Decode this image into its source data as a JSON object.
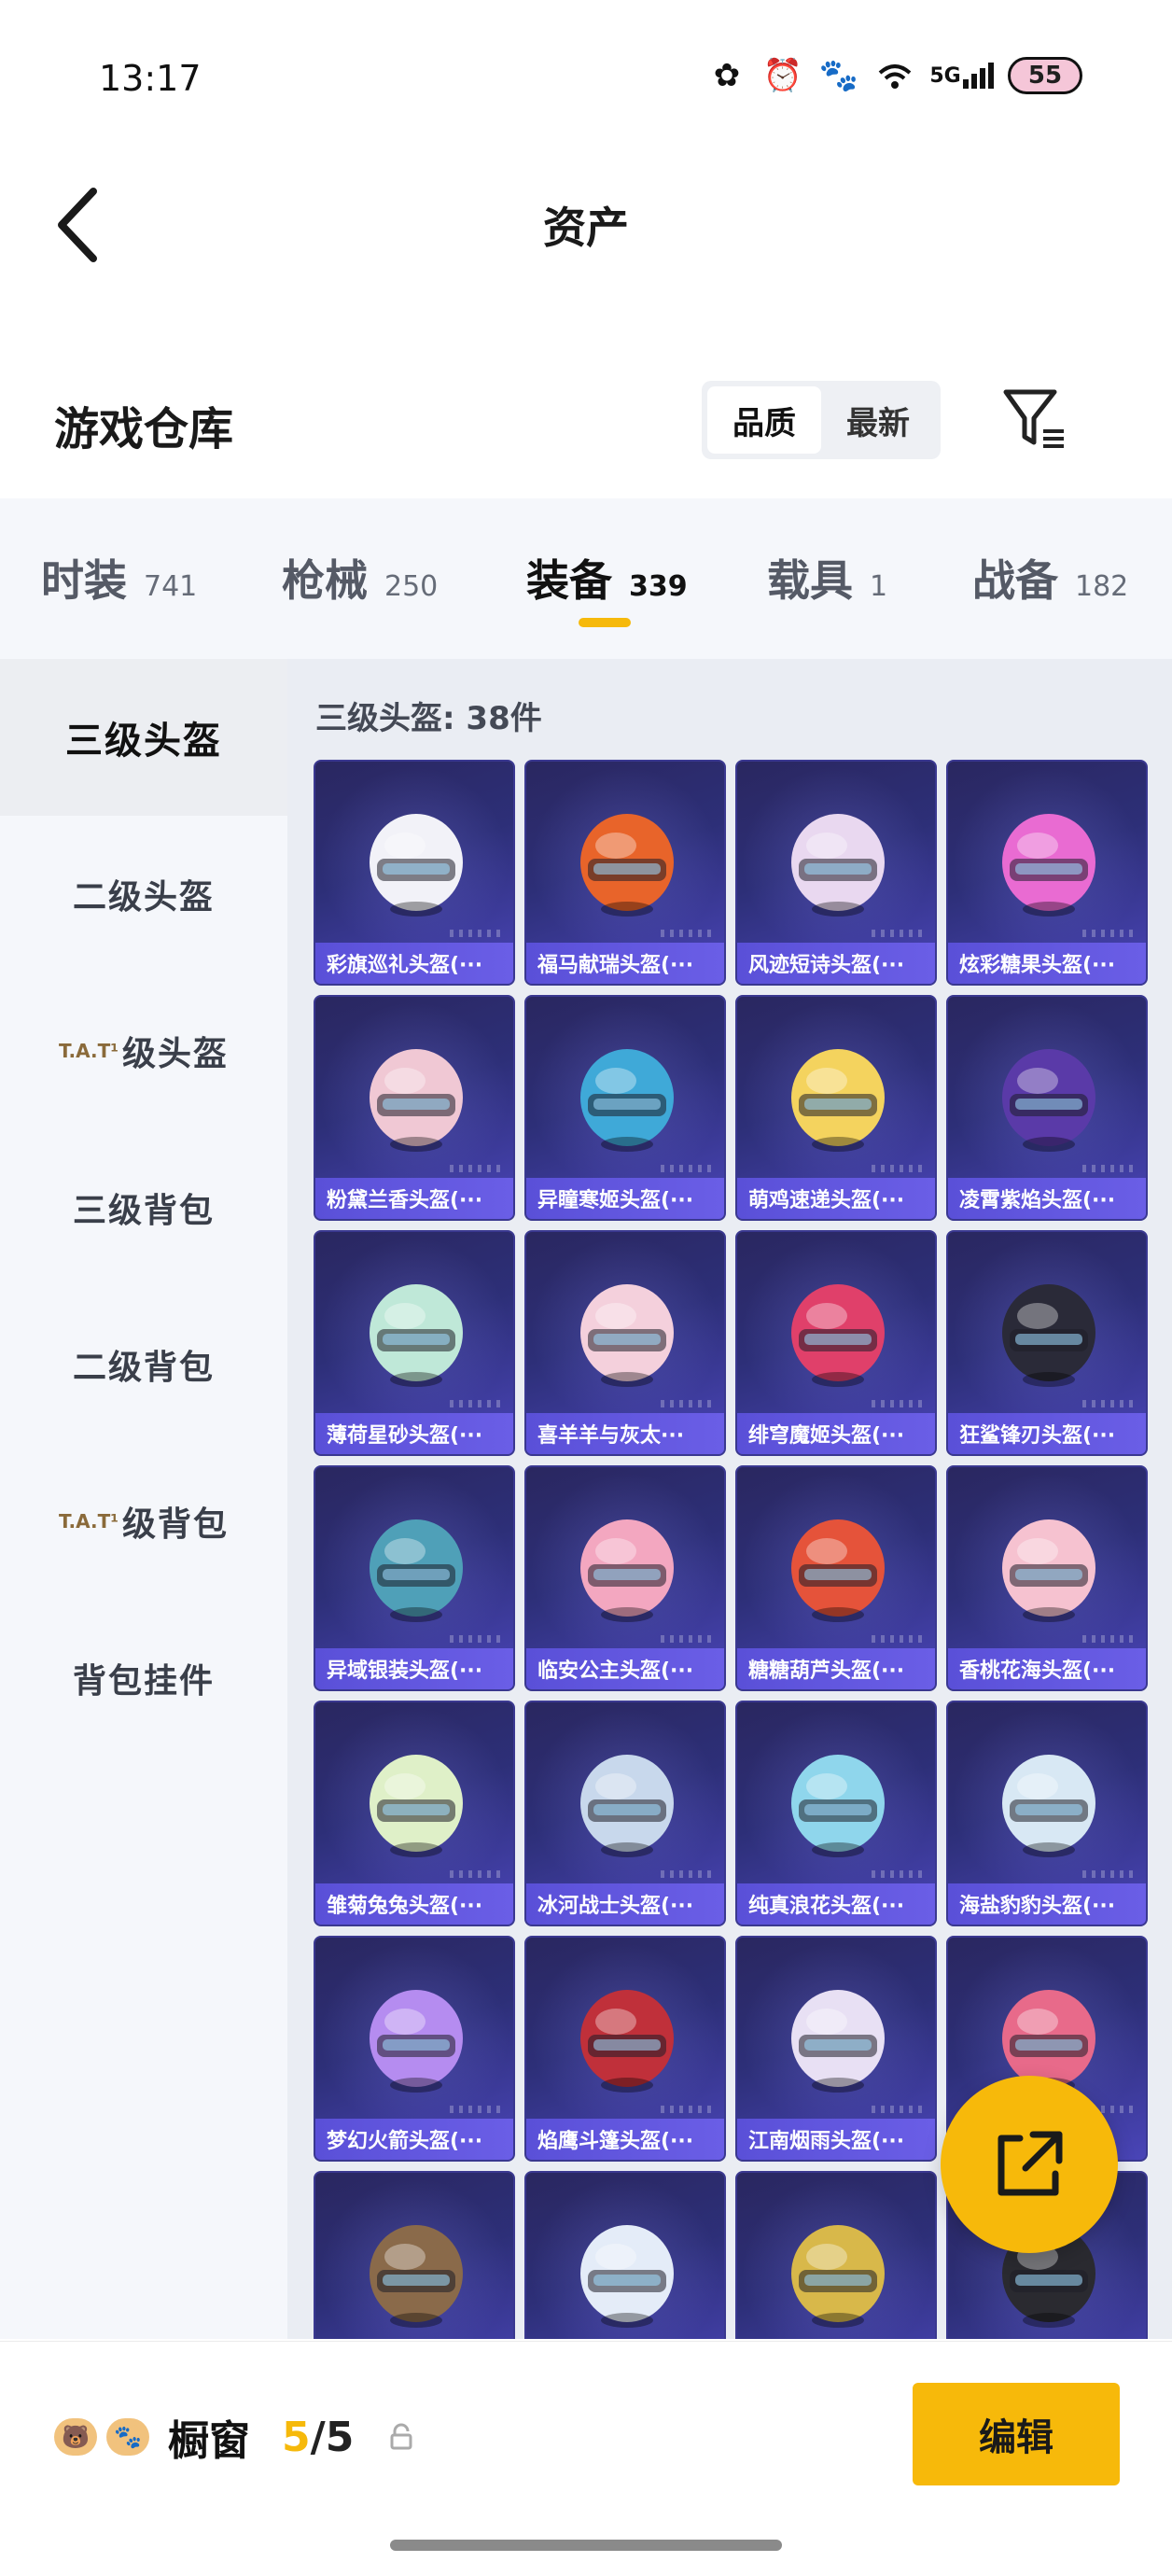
{
  "status_bar": {
    "time": "13:17",
    "network": "5G",
    "battery": "55"
  },
  "header": {
    "title": "资产"
  },
  "warehouse": {
    "title": "游戏仓库",
    "sort": [
      "品质",
      "最新"
    ]
  },
  "tabs": [
    {
      "label": "时装",
      "count": "741"
    },
    {
      "label": "枪械",
      "count": "250"
    },
    {
      "label": "装备",
      "count": "339"
    },
    {
      "label": "载具",
      "count": "1"
    },
    {
      "label": "战备",
      "count": "182"
    }
  ],
  "side_nav": [
    {
      "label": "三级头盔"
    },
    {
      "label": "二级头盔"
    },
    {
      "glitch": "T.A.T¹",
      "label": "级头盔"
    },
    {
      "label": "三级背包"
    },
    {
      "label": "二级背包"
    },
    {
      "glitch": "T.A.T¹",
      "label": "级背包"
    },
    {
      "label": "背包挂件"
    }
  ],
  "content": {
    "count_label": "三级头盔: 38件",
    "items": [
      {
        "name": "彩旗巡礼头盔(···",
        "accent": "#f2f2f8"
      },
      {
        "name": "福马献瑞头盔(···",
        "accent": "#e8642a"
      },
      {
        "name": "风迹短诗头盔(···",
        "accent": "#e9d8f0"
      },
      {
        "name": "炫彩糖果头盔(···",
        "accent": "#e96bd2"
      },
      {
        "name": "粉黛兰香头盔(···",
        "accent": "#f0c8d4"
      },
      {
        "name": "异瞳寒姬头盔(···",
        "accent": "#3fa9d8"
      },
      {
        "name": "萌鸡速递头盔(···",
        "accent": "#f4d35e"
      },
      {
        "name": "凌霄紫焰头盔(···",
        "accent": "#5a3aa8"
      },
      {
        "name": "薄荷星砂头盔(···",
        "accent": "#bfe8d8"
      },
      {
        "name": "喜羊羊与灰太···",
        "accent": "#f4d0dc"
      },
      {
        "name": "绯穹魔姬头盔(···",
        "accent": "#e0406a"
      },
      {
        "name": "狂鲨锋刃头盔(···",
        "accent": "#2a2a38"
      },
      {
        "name": "异域银装头盔(···",
        "accent": "#4fa0b8"
      },
      {
        "name": "临安公主头盔(···",
        "accent": "#f3a7c0"
      },
      {
        "name": "糖糖葫芦头盔(···",
        "accent": "#e5533a"
      },
      {
        "name": "香桃花海头盔(···",
        "accent": "#f6c2d0"
      },
      {
        "name": "雏菊兔兔头盔(···",
        "accent": "#dff0c8"
      },
      {
        "name": "冰河战士头盔(···",
        "accent": "#c8d8ec"
      },
      {
        "name": "纯真浪花头盔(···",
        "accent": "#8fd6ec"
      },
      {
        "name": "海盐豹豹头盔(···",
        "accent": "#d8e8f4"
      },
      {
        "name": "梦幻火箭头盔(···",
        "accent": "#b58cf0"
      },
      {
        "name": "焰鹰斗篷头盔(···",
        "accent": "#c0303a"
      },
      {
        "name": "江南烟雨头盔(···",
        "accent": "#e8e0f4"
      },
      {
        "name": "",
        "accent": "#e86a8a"
      },
      {
        "name": "",
        "accent": "#8a6a4a"
      },
      {
        "name": "",
        "accent": "#e4ecf8"
      },
      {
        "name": "",
        "accent": "#d8b84a"
      },
      {
        "name": "",
        "accent": "#2a2a30"
      }
    ]
  },
  "bottom_bar": {
    "showcase_label": "橱窗",
    "showcase_current": "5",
    "showcase_sep": "/",
    "showcase_total": "5",
    "edit_label": "编辑"
  },
  "colors": {
    "accent": "#f7b90a",
    "card_bg": "#2d2f78",
    "name_band": "#6a5ee6"
  }
}
